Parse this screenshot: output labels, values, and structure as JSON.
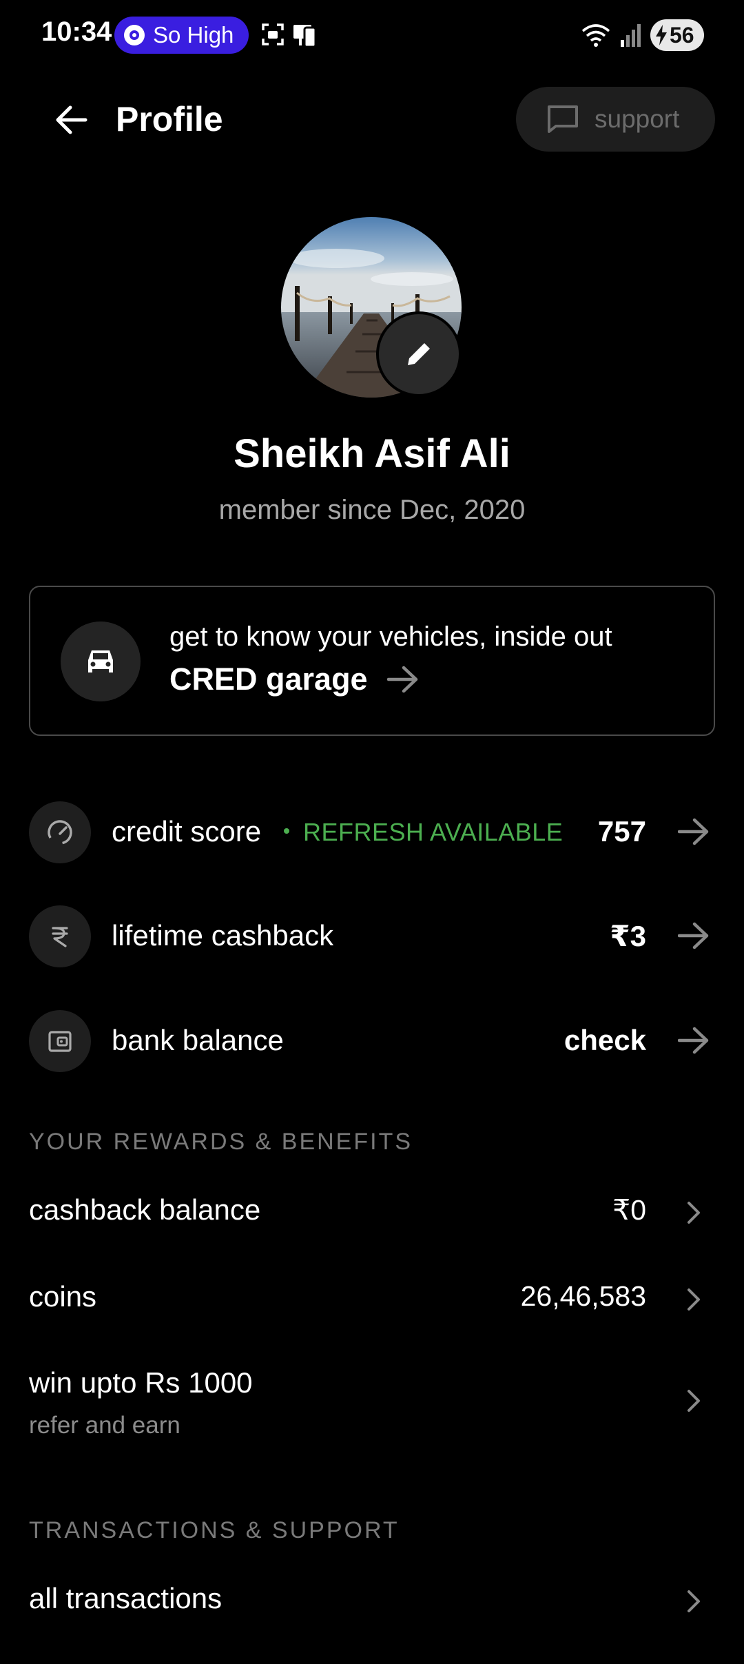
{
  "status_bar": {
    "time": "10:34",
    "pill_label": "So High",
    "battery": "56"
  },
  "header": {
    "title": "Profile",
    "support_label": "support"
  },
  "profile": {
    "name": "Sheikh Asif Ali",
    "member_since": "member since Dec, 2020"
  },
  "garage": {
    "tagline": "get to know your vehicles, inside out",
    "cta": "CRED garage"
  },
  "stats": [
    {
      "label": "credit score",
      "badge": "REFRESH AVAILABLE",
      "value": "757",
      "icon": "speedometer-icon"
    },
    {
      "label": "lifetime cashback",
      "value": "₹3",
      "icon": "rupee-icon"
    },
    {
      "label": "bank balance",
      "value": "check",
      "icon": "wallet-icon"
    }
  ],
  "rewards": {
    "section_title": "YOUR REWARDS & BENEFITS",
    "items": [
      {
        "label": "cashback balance",
        "value": "₹0"
      },
      {
        "label": "coins",
        "value": "26,46,583"
      },
      {
        "label": "win upto Rs 1000",
        "sub": "refer and earn"
      }
    ]
  },
  "transactions": {
    "section_title": "TRANSACTIONS & SUPPORT",
    "items": [
      {
        "label": "all transactions"
      }
    ]
  },
  "colors": {
    "background": "#000000",
    "badge_green": "#4caf50",
    "status_pill": "#3a1ee0"
  }
}
